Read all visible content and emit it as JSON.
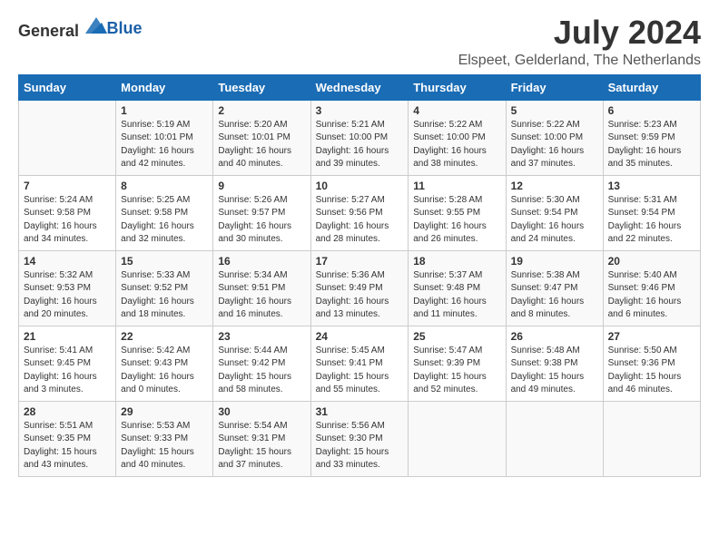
{
  "logo": {
    "general": "General",
    "blue": "Blue"
  },
  "title": "July 2024",
  "location": "Elspeet, Gelderland, The Netherlands",
  "headers": [
    "Sunday",
    "Monday",
    "Tuesday",
    "Wednesday",
    "Thursday",
    "Friday",
    "Saturday"
  ],
  "weeks": [
    [
      {
        "day": "",
        "info": ""
      },
      {
        "day": "1",
        "info": "Sunrise: 5:19 AM\nSunset: 10:01 PM\nDaylight: 16 hours\nand 42 minutes."
      },
      {
        "day": "2",
        "info": "Sunrise: 5:20 AM\nSunset: 10:01 PM\nDaylight: 16 hours\nand 40 minutes."
      },
      {
        "day": "3",
        "info": "Sunrise: 5:21 AM\nSunset: 10:00 PM\nDaylight: 16 hours\nand 39 minutes."
      },
      {
        "day": "4",
        "info": "Sunrise: 5:22 AM\nSunset: 10:00 PM\nDaylight: 16 hours\nand 38 minutes."
      },
      {
        "day": "5",
        "info": "Sunrise: 5:22 AM\nSunset: 10:00 PM\nDaylight: 16 hours\nand 37 minutes."
      },
      {
        "day": "6",
        "info": "Sunrise: 5:23 AM\nSunset: 9:59 PM\nDaylight: 16 hours\nand 35 minutes."
      }
    ],
    [
      {
        "day": "7",
        "info": "Sunrise: 5:24 AM\nSunset: 9:58 PM\nDaylight: 16 hours\nand 34 minutes."
      },
      {
        "day": "8",
        "info": "Sunrise: 5:25 AM\nSunset: 9:58 PM\nDaylight: 16 hours\nand 32 minutes."
      },
      {
        "day": "9",
        "info": "Sunrise: 5:26 AM\nSunset: 9:57 PM\nDaylight: 16 hours\nand 30 minutes."
      },
      {
        "day": "10",
        "info": "Sunrise: 5:27 AM\nSunset: 9:56 PM\nDaylight: 16 hours\nand 28 minutes."
      },
      {
        "day": "11",
        "info": "Sunrise: 5:28 AM\nSunset: 9:55 PM\nDaylight: 16 hours\nand 26 minutes."
      },
      {
        "day": "12",
        "info": "Sunrise: 5:30 AM\nSunset: 9:54 PM\nDaylight: 16 hours\nand 24 minutes."
      },
      {
        "day": "13",
        "info": "Sunrise: 5:31 AM\nSunset: 9:54 PM\nDaylight: 16 hours\nand 22 minutes."
      }
    ],
    [
      {
        "day": "14",
        "info": "Sunrise: 5:32 AM\nSunset: 9:53 PM\nDaylight: 16 hours\nand 20 minutes."
      },
      {
        "day": "15",
        "info": "Sunrise: 5:33 AM\nSunset: 9:52 PM\nDaylight: 16 hours\nand 18 minutes."
      },
      {
        "day": "16",
        "info": "Sunrise: 5:34 AM\nSunset: 9:51 PM\nDaylight: 16 hours\nand 16 minutes."
      },
      {
        "day": "17",
        "info": "Sunrise: 5:36 AM\nSunset: 9:49 PM\nDaylight: 16 hours\nand 13 minutes."
      },
      {
        "day": "18",
        "info": "Sunrise: 5:37 AM\nSunset: 9:48 PM\nDaylight: 16 hours\nand 11 minutes."
      },
      {
        "day": "19",
        "info": "Sunrise: 5:38 AM\nSunset: 9:47 PM\nDaylight: 16 hours\nand 8 minutes."
      },
      {
        "day": "20",
        "info": "Sunrise: 5:40 AM\nSunset: 9:46 PM\nDaylight: 16 hours\nand 6 minutes."
      }
    ],
    [
      {
        "day": "21",
        "info": "Sunrise: 5:41 AM\nSunset: 9:45 PM\nDaylight: 16 hours\nand 3 minutes."
      },
      {
        "day": "22",
        "info": "Sunrise: 5:42 AM\nSunset: 9:43 PM\nDaylight: 16 hours\nand 0 minutes."
      },
      {
        "day": "23",
        "info": "Sunrise: 5:44 AM\nSunset: 9:42 PM\nDaylight: 15 hours\nand 58 minutes."
      },
      {
        "day": "24",
        "info": "Sunrise: 5:45 AM\nSunset: 9:41 PM\nDaylight: 15 hours\nand 55 minutes."
      },
      {
        "day": "25",
        "info": "Sunrise: 5:47 AM\nSunset: 9:39 PM\nDaylight: 15 hours\nand 52 minutes."
      },
      {
        "day": "26",
        "info": "Sunrise: 5:48 AM\nSunset: 9:38 PM\nDaylight: 15 hours\nand 49 minutes."
      },
      {
        "day": "27",
        "info": "Sunrise: 5:50 AM\nSunset: 9:36 PM\nDaylight: 15 hours\nand 46 minutes."
      }
    ],
    [
      {
        "day": "28",
        "info": "Sunrise: 5:51 AM\nSunset: 9:35 PM\nDaylight: 15 hours\nand 43 minutes."
      },
      {
        "day": "29",
        "info": "Sunrise: 5:53 AM\nSunset: 9:33 PM\nDaylight: 15 hours\nand 40 minutes."
      },
      {
        "day": "30",
        "info": "Sunrise: 5:54 AM\nSunset: 9:31 PM\nDaylight: 15 hours\nand 37 minutes."
      },
      {
        "day": "31",
        "info": "Sunrise: 5:56 AM\nSunset: 9:30 PM\nDaylight: 15 hours\nand 33 minutes."
      },
      {
        "day": "",
        "info": ""
      },
      {
        "day": "",
        "info": ""
      },
      {
        "day": "",
        "info": ""
      }
    ]
  ]
}
